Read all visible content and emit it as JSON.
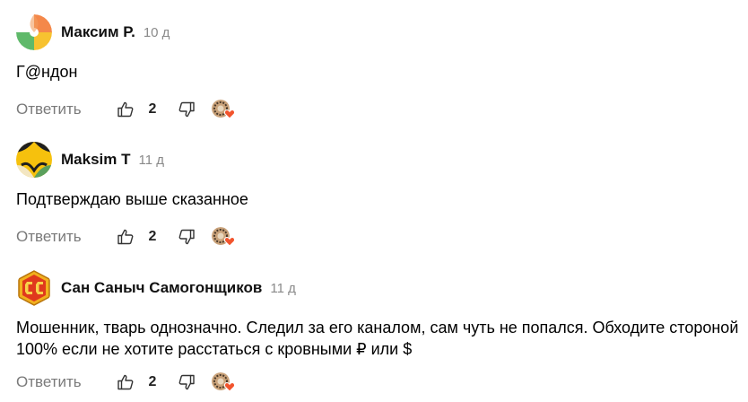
{
  "comments": [
    {
      "author": "Максим Р.",
      "age": "10 д",
      "text": "Г@ндон",
      "reply_label": "Ответить",
      "likes": "2"
    },
    {
      "author": "Maksim T",
      "age": "11 д",
      "text": "Подтверждаю выше сказанное",
      "reply_label": "Ответить",
      "likes": "2"
    },
    {
      "author": "Сан Саныч Самогонщиков",
      "age": "11 д",
      "text": "Мошенник, тварь однозначно. Следил за его каналом, сам чуть не попался. Обходите стороной 100% если не хотите расстаться с кровными ₽ или $",
      "reply_label": "Ответить",
      "likes": "2"
    }
  ],
  "icons": {
    "like": "thumbs-up-icon",
    "dislike": "thumbs-down-icon",
    "reactions": "reaction-avatar-heart-icon"
  },
  "colors": {
    "reply": "#7a7a7a",
    "age": "#8a8a8a",
    "heart": "#f2542d"
  }
}
